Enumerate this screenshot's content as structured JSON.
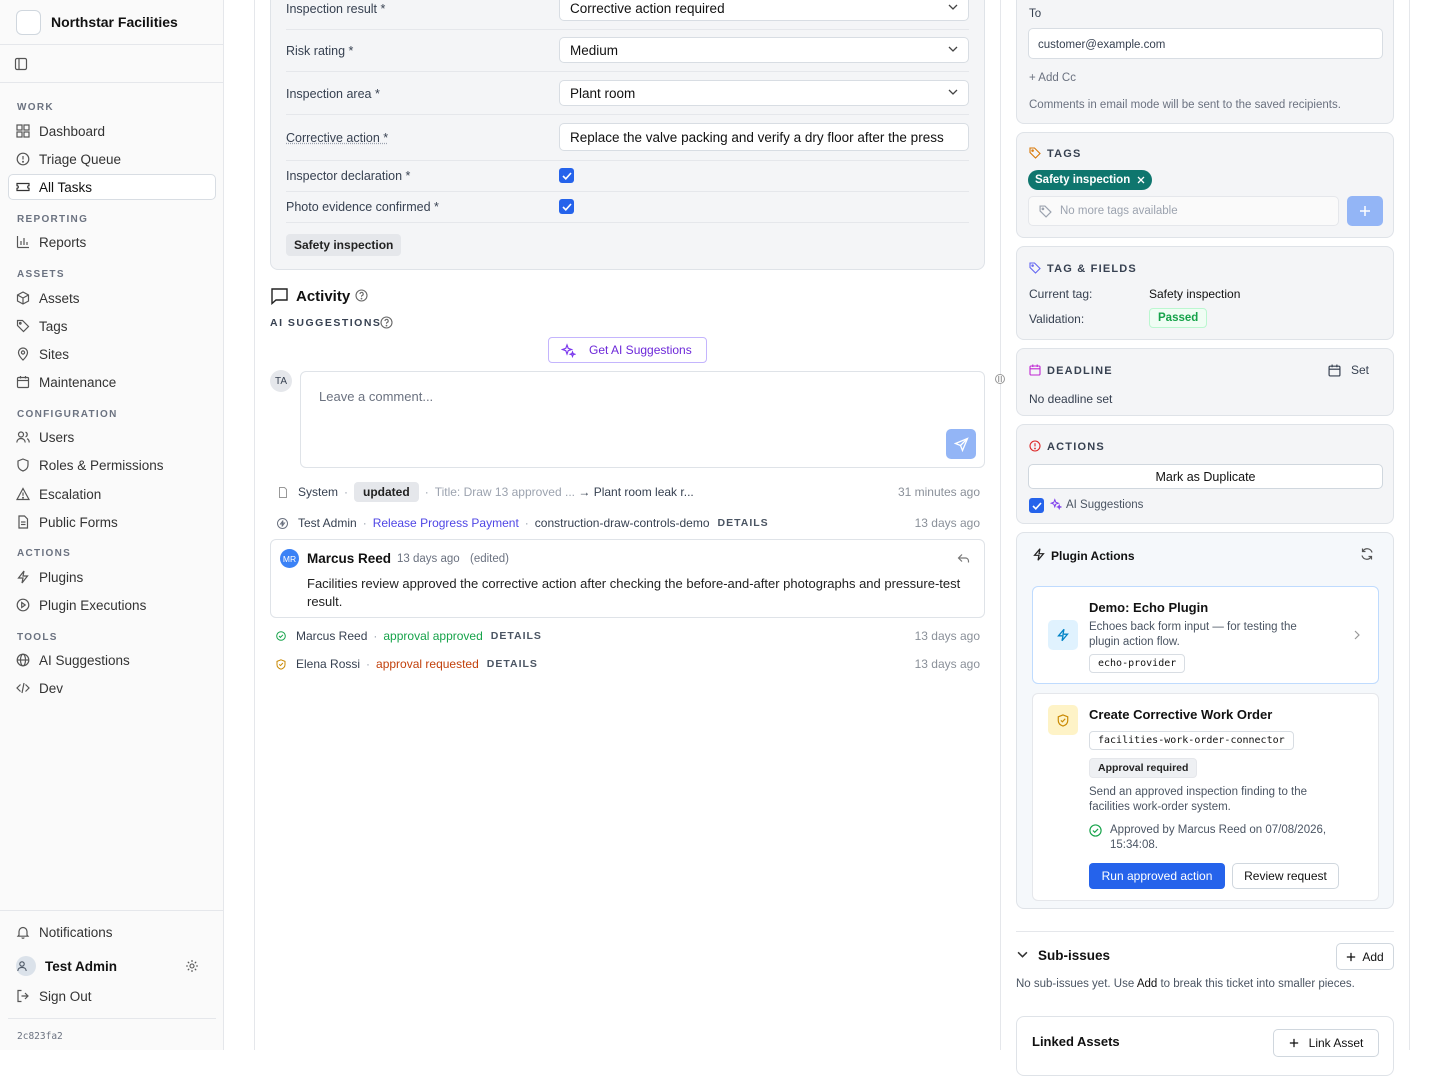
{
  "app": {
    "name": "Northstar Facilities",
    "commit": "2c823fa2"
  },
  "sidebar": {
    "sections": [
      {
        "title": "WORK",
        "items": [
          {
            "label": "Dashboard",
            "icon": "grid-icon"
          },
          {
            "label": "Triage Queue",
            "icon": "alert-circle-icon"
          },
          {
            "label": "All Tasks",
            "icon": "ticket-icon",
            "active": true
          }
        ]
      },
      {
        "title": "REPORTING",
        "items": [
          {
            "label": "Reports",
            "icon": "bar-chart-icon"
          }
        ]
      },
      {
        "title": "ASSETS",
        "items": [
          {
            "label": "Assets",
            "icon": "box-icon"
          },
          {
            "label": "Tags",
            "icon": "tag-icon"
          },
          {
            "label": "Sites",
            "icon": "map-pin-icon"
          },
          {
            "label": "Maintenance",
            "icon": "calendar-icon"
          }
        ]
      },
      {
        "title": "CONFIGURATION",
        "items": [
          {
            "label": "Users",
            "icon": "users-icon"
          },
          {
            "label": "Roles & Permissions",
            "icon": "shield-icon"
          },
          {
            "label": "Escalation",
            "icon": "warning-icon"
          },
          {
            "label": "Public Forms",
            "icon": "file-icon"
          }
        ]
      },
      {
        "title": "ACTIONS",
        "items": [
          {
            "label": "Plugins",
            "icon": "zap-icon"
          },
          {
            "label": "Plugin Executions",
            "icon": "play-circle-icon"
          }
        ]
      },
      {
        "title": "TOOLS",
        "items": [
          {
            "label": "AI Suggestions",
            "icon": "globe-icon"
          },
          {
            "label": "Dev",
            "icon": "code-icon"
          }
        ]
      }
    ],
    "footer": {
      "notifications": "Notifications",
      "user": "Test Admin",
      "signout": "Sign Out"
    }
  },
  "form": {
    "inspection_result": {
      "label": "Inspection result *",
      "value": "Corrective action required"
    },
    "risk_rating": {
      "label": "Risk rating *",
      "value": "Medium"
    },
    "inspection_area": {
      "label": "Inspection area *",
      "value": "Plant room"
    },
    "corrective_action": {
      "label": "Corrective action *",
      "value": "Replace the valve packing and verify a dry floor after the press"
    },
    "inspector_declaration": {
      "label": "Inspector declaration *",
      "checked": true
    },
    "photo_evidence": {
      "label": "Photo evidence confirmed *",
      "checked": true
    },
    "tag": "Safety inspection"
  },
  "activity": {
    "title": "Activity",
    "ai_label": "AI SUGGESTIONS",
    "ai_button": "Get AI Suggestions",
    "avatar": "TA",
    "comment_placeholder": "Leave a comment...",
    "events": [
      {
        "actor": "System",
        "badge": "updated",
        "detail_prefix": "Title:",
        "detail_old": "Draw 13 approved ...",
        "detail_arrow": "→",
        "detail_new": "Plant room leak r...",
        "time": "31 minutes ago"
      },
      {
        "actor": "Test Admin",
        "action": "Release Progress Payment",
        "ref": "construction-draw-controls-demo",
        "details": "DETAILS",
        "time": "13 days ago"
      }
    ],
    "comment": {
      "initials": "MR",
      "author": "Marcus Reed",
      "time": "13 days ago",
      "edited": "(edited)",
      "body": "Facilities review approved the corrective action after checking the before-and-after photographs and pressure-test result."
    },
    "approvals": [
      {
        "actor": "Marcus Reed",
        "status": "approval approved",
        "details": "DETAILS",
        "time": "13 days ago"
      },
      {
        "actor": "Elena Rossi",
        "status": "approval requested",
        "details": "DETAILS",
        "time": "13 days ago"
      }
    ]
  },
  "right": {
    "email": {
      "to_label": "To",
      "to_value": "customer@example.com",
      "add_cc": "+ Add Cc",
      "note": "Comments in email mode will be sent to the saved recipients."
    },
    "tags": {
      "title": "TAGS",
      "chip": "Safety inspection",
      "placeholder": "No more tags available"
    },
    "tag_fields": {
      "title": "TAG & FIELDS",
      "current_label": "Current tag:",
      "current_value": "Safety inspection",
      "validation_label": "Validation:",
      "validation_value": "Passed"
    },
    "deadline": {
      "title": "DEADLINE",
      "set": "Set",
      "none": "No deadline set"
    },
    "actions": {
      "title": "ACTIONS",
      "duplicate": "Mark as Duplicate",
      "ai": "AI Suggestions"
    },
    "plugins": {
      "title": "Plugin Actions",
      "echo": {
        "name": "Demo: Echo Plugin",
        "desc": "Echoes back form input — for testing the plugin action flow.",
        "provider": "echo-provider"
      },
      "work_order": {
        "name": "Create Corrective Work Order",
        "provider": "facilities-work-order-connector",
        "badge": "Approval required",
        "desc": "Send an approved inspection finding to the facilities work-order system.",
        "approved": "Approved by Marcus Reed on 07/08/2026, 15:34:08.",
        "run": "Run approved action",
        "review": "Review request"
      }
    },
    "subissues": {
      "title": "Sub-issues",
      "add": "Add",
      "note_a": "No sub-issues yet. Use ",
      "note_b": "Add",
      "note_c": " to break this ticket into smaller pieces."
    },
    "linked": {
      "title": "Linked Assets",
      "button": "Link Asset"
    }
  },
  "colors": {
    "accent": "#2563eb",
    "tag_green": "#0f766e",
    "passed": "#16a34a",
    "approved": "#16a34a",
    "requested": "#c2410c",
    "link": "#4f46e5",
    "ai_purple": "#7c3aed"
  }
}
